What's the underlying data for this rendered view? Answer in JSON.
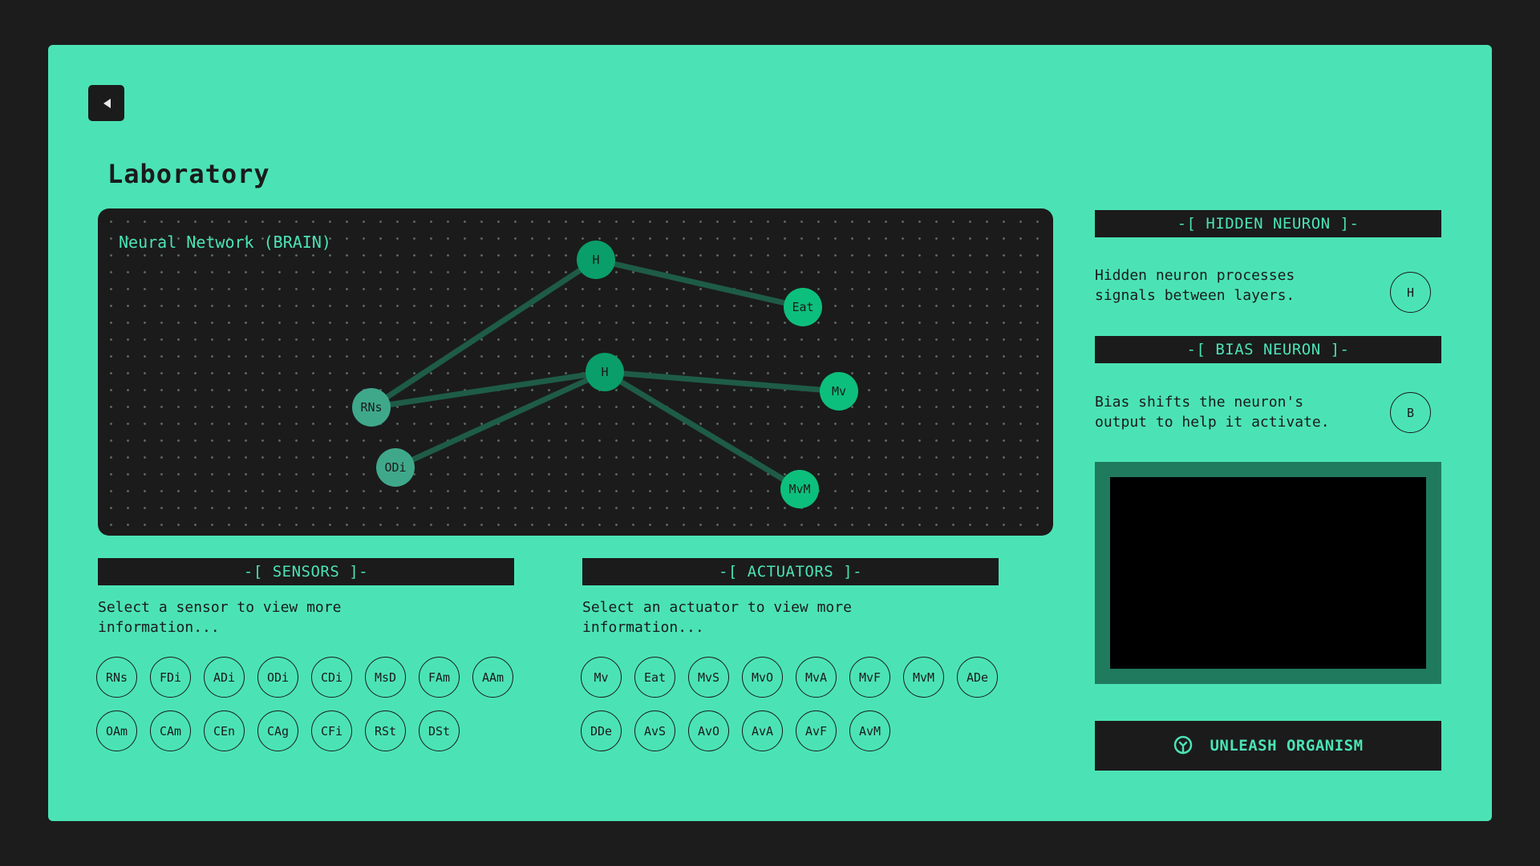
{
  "header": {
    "title": "Laboratory"
  },
  "brain": {
    "title": "Neural Network (BRAIN)",
    "nodes": [
      {
        "label": "H",
        "color": "#0a9e6a"
      },
      {
        "label": "Eat",
        "color": "#0dbf7c"
      },
      {
        "label": "H",
        "color": "#0a9e6a"
      },
      {
        "label": "Mv",
        "color": "#0dbf7c"
      },
      {
        "label": "RNs",
        "color": "#3fa88b"
      },
      {
        "label": "ODi",
        "color": "#3fa88b"
      },
      {
        "label": "MvM",
        "color": "#0dbf7c"
      }
    ]
  },
  "sensors": {
    "header": "-[ SENSORS ]-",
    "description": "Select a sensor to view more information...",
    "items": [
      "RNs",
      "FDi",
      "ADi",
      "ODi",
      "CDi",
      "MsD",
      "FAm",
      "AAm",
      "OAm",
      "CAm",
      "CEn",
      "CAg",
      "CFi",
      "RSt",
      "DSt"
    ]
  },
  "actuators": {
    "header": "-[ ACTUATORS ]-",
    "description": "Select an actuator to view more information...",
    "items": [
      "Mv",
      "Eat",
      "MvS",
      "MvO",
      "MvA",
      "MvF",
      "MvM",
      "ADe",
      "DDe",
      "AvS",
      "AvO",
      "AvA",
      "AvF",
      "AvM"
    ]
  },
  "hidden": {
    "header": "-[ HIDDEN NEURON ]-",
    "description": "Hidden neuron processes signals between layers.",
    "symbol": "H"
  },
  "bias": {
    "header": "-[ BIAS NEURON ]-",
    "description": "Bias shifts the neuron's output to help it activate.",
    "symbol": "B"
  },
  "actions": {
    "unleash_label": "UNLEASH ORGANISM"
  },
  "colors": {
    "background": "#1c1c1c",
    "panel": "#4be3b5",
    "dark": "#1b1b1b",
    "edge": "#1e5c47",
    "preview_frame": "#207a5d"
  }
}
